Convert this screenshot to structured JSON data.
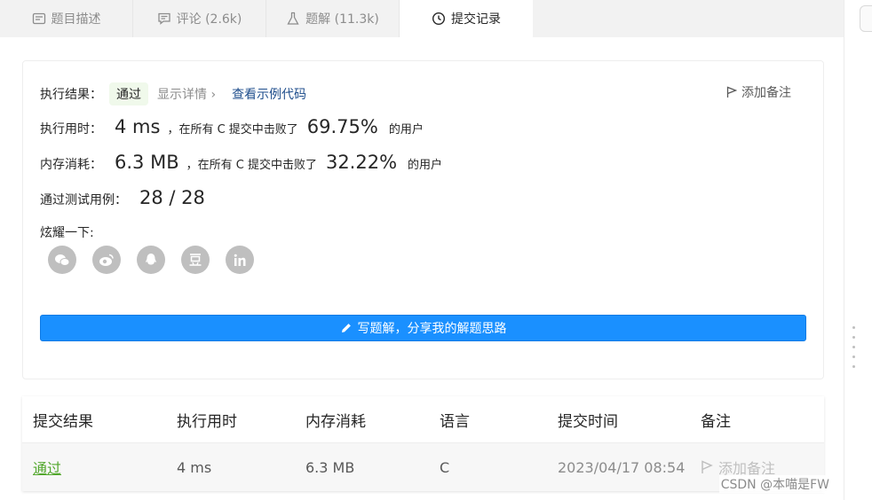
{
  "tabs": [
    {
      "label": "题目描述",
      "icon": "description-icon",
      "active": false
    },
    {
      "label": "评论 (2.6k)",
      "icon": "comment-icon",
      "active": false
    },
    {
      "label": "题解 (11.3k)",
      "icon": "flask-icon",
      "active": false
    },
    {
      "label": "提交记录",
      "icon": "clock-icon",
      "active": true
    }
  ],
  "result": {
    "status_label": "执行结果：",
    "status_value": "通过",
    "detail_link": "显示详情 ›",
    "example_link": "查看示例代码",
    "add_note": "添加备注",
    "time_label": "执行用时：",
    "time_value": "4 ms",
    "time_mid": "，在所有 C 提交中击败了",
    "time_percent": "69.75%",
    "time_suffix": "的用户",
    "mem_label": "内存消耗：",
    "mem_value": "6.3 MB",
    "mem_mid": "，在所有 C 提交中击败了",
    "mem_percent": "32.22%",
    "mem_suffix": "的用户",
    "tests_label": "通过测试用例：",
    "tests_value": "28 / 28",
    "share_label": "炫耀一下:",
    "share_icons": [
      {
        "name": "wechat-icon",
        "glyph": "●●"
      },
      {
        "name": "weibo-icon",
        "glyph": "◉"
      },
      {
        "name": "qq-icon",
        "glyph": "▲"
      },
      {
        "name": "douban-icon",
        "glyph": "豆"
      },
      {
        "name": "linkedin-icon",
        "glyph": "in"
      }
    ],
    "write_button": "写题解，分享我的解题思路"
  },
  "table": {
    "headers": [
      "提交结果",
      "执行用时",
      "内存消耗",
      "语言",
      "提交时间",
      "备注"
    ],
    "rows": [
      {
        "result": "通过",
        "time": "4 ms",
        "memory": "6.3 MB",
        "lang": "C",
        "submitted": "2023/04/17 08:54",
        "note": "添加备注"
      }
    ]
  },
  "watermark": "CSDN @本喵是FW",
  "colors": {
    "accent": "#1a90ff",
    "pass": "#52a72c",
    "link": "#1f4e8c"
  }
}
